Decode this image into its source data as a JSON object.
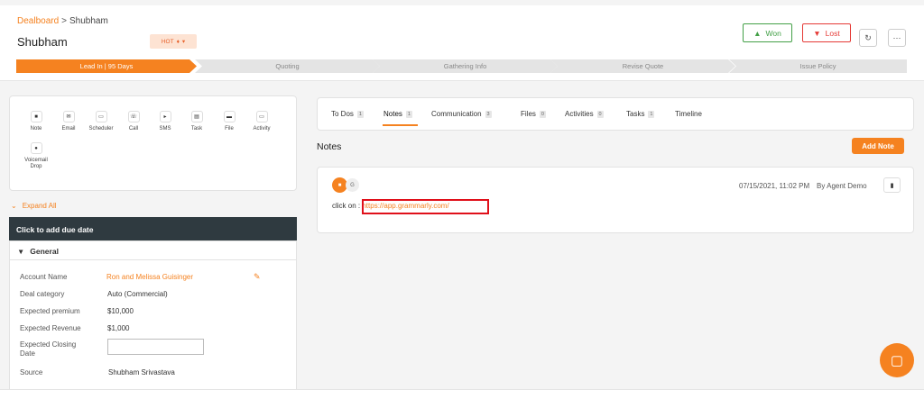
{
  "breadcrumb": {
    "parent": "Dealboard",
    "separator": ">",
    "current": "Shubham"
  },
  "deal": {
    "title": "Shubham",
    "badge": "HOT"
  },
  "actions": {
    "won": "Won",
    "lost": "Lost"
  },
  "pipeline": [
    "Lead In | 95 Days",
    "Quoting",
    "Gathering Info",
    "Revise Quote",
    "Issue Policy"
  ],
  "activity_buttons": [
    {
      "label": "Note",
      "icon": "note-icon"
    },
    {
      "label": "Email",
      "icon": "email-icon"
    },
    {
      "label": "Scheduler",
      "icon": "calendar-icon"
    },
    {
      "label": "Call",
      "icon": "phone-icon"
    },
    {
      "label": "SMS",
      "icon": "sms-icon"
    },
    {
      "label": "Task",
      "icon": "task-icon"
    },
    {
      "label": "File",
      "icon": "folder-icon"
    },
    {
      "label": "Activity",
      "icon": "activity-icon"
    },
    {
      "label": "Voicemail Drop",
      "icon": "mic-icon"
    }
  ],
  "sidebar": {
    "expand_all": "Expand All",
    "due_date": "Click to add due date",
    "general": "General",
    "fields": {
      "account_name": {
        "label": "Account Name",
        "value": "Ron and Melissa Guisinger"
      },
      "deal_category": {
        "label": "Deal category",
        "value": "Auto (Commercial)"
      },
      "expected_premium": {
        "label": "Expected premium",
        "value": "$10,000"
      },
      "expected_revenue": {
        "label": "Expected Revenue",
        "value": "$1,000"
      },
      "expected_closing": {
        "label": "Expected Closing Date",
        "value": ""
      },
      "source": {
        "label": "Source",
        "value": "Shubham Srivastava"
      }
    }
  },
  "tabs": [
    {
      "label": "To Dos",
      "count": "1"
    },
    {
      "label": "Notes",
      "count": "1"
    },
    {
      "label": "Communication",
      "count": "3"
    },
    {
      "label": "Files",
      "count": "0"
    },
    {
      "label": "Activities",
      "count": "0"
    },
    {
      "label": "Tasks",
      "count": "1"
    },
    {
      "label": "Timeline",
      "count": ""
    }
  ],
  "notes": {
    "heading": "Notes",
    "add_button": "Add Note",
    "items": [
      {
        "avatar": "G",
        "datetime": "07/15/2021, 11:02 PM",
        "author": "By Agent Demo",
        "prefix": "click on :",
        "link": "https://app.grammarly.com/"
      }
    ]
  },
  "colors": {
    "accent": "#f58220",
    "dark": "#2f3a40",
    "won": "#43a047",
    "lost": "#e53935",
    "highlight": "#e0101a"
  }
}
